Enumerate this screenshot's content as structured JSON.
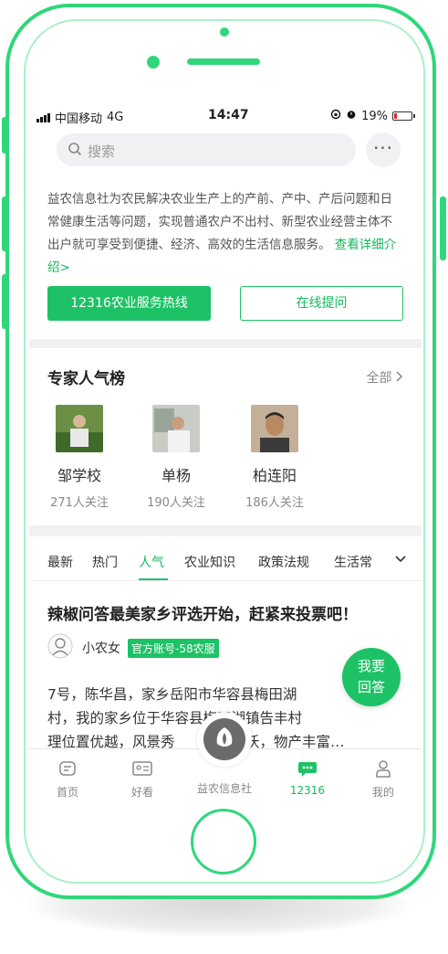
{
  "status_bar": {
    "carrier": "中国移动",
    "network": "4G",
    "time": "14:47",
    "battery": "19%",
    "battery_level": 0.19
  },
  "search": {
    "placeholder": "搜索",
    "more": "···"
  },
  "intro": {
    "text": "益农信息社为农民解决农业生产上的产前、产中、产后问题和日常健康生活等问题，实现普通农户不出村、新型农业经营主体不出户就可享受到便捷、经济、高效的生活信息服务。",
    "link": "查看详细介绍>"
  },
  "buttons": {
    "hotline": "12316农业服务热线",
    "ask": "在线提问"
  },
  "experts": {
    "title": "专家人气榜",
    "all_label": "全部",
    "items": [
      {
        "name": "邹学校",
        "followers": "271人关注"
      },
      {
        "name": "单杨",
        "followers": "190人关注"
      },
      {
        "name": "柏连阳",
        "followers": "186人关注"
      }
    ]
  },
  "tabs": {
    "items": [
      "最新",
      "热门",
      "人气",
      "农业知识",
      "政策法规",
      "生活常"
    ],
    "active": "人气"
  },
  "post": {
    "title": "辣椒问答最美家乡评选开始，赶紧来投票吧！",
    "author": "小农女",
    "badge": "官方账号-58农服",
    "body_line1": "7号，陈华昌，家乡岳阳市华容县梅田湖",
    "body_line2": "村，我的家乡位于华容县梅田湖镇告丰村",
    "body_line3": "理位置优越，风景秀　　　地肥沃，物产丰富…"
  },
  "fab": {
    "line1": "我要",
    "line2": "回答"
  },
  "tabbar": {
    "home": "首页",
    "watch": "好看",
    "center": "益农信息社",
    "hotline": "12316",
    "mine": "我的"
  },
  "colors": {
    "accent": "#1ec266",
    "phone_frame": "#2fd77a"
  }
}
